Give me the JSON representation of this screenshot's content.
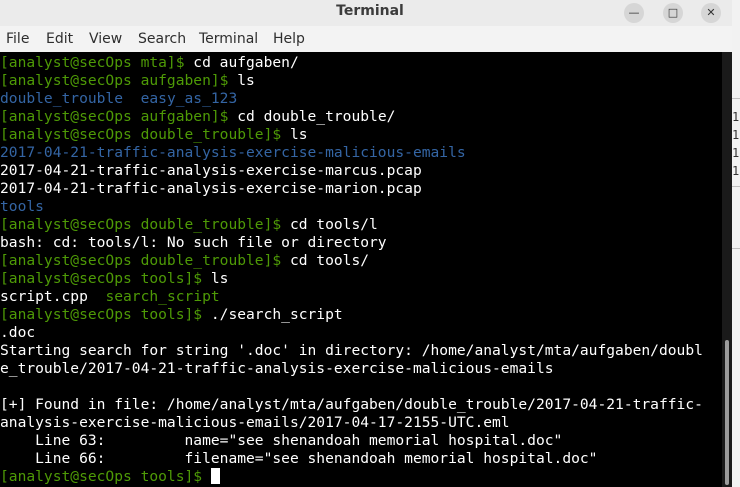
{
  "window": {
    "title": "Terminal"
  },
  "menu": [
    "File",
    "Edit",
    "View",
    "Search",
    "Terminal",
    "Help"
  ],
  "terminal": {
    "lines": [
      [
        {
          "t": "[analyst@secOps mta]$ ",
          "c": "prompt"
        },
        {
          "t": "cd aufgaben/",
          "c": ""
        }
      ],
      [
        {
          "t": "[analyst@secOps aufgaben]$ ",
          "c": "prompt"
        },
        {
          "t": "ls",
          "c": ""
        }
      ],
      [
        {
          "t": "double_trouble",
          "c": "dir"
        },
        {
          "t": "  ",
          "c": ""
        },
        {
          "t": "easy_as_123",
          "c": "dir"
        }
      ],
      [
        {
          "t": "[analyst@secOps aufgaben]$ ",
          "c": "prompt"
        },
        {
          "t": "cd double_trouble/",
          "c": ""
        }
      ],
      [
        {
          "t": "[analyst@secOps double_trouble]$ ",
          "c": "prompt"
        },
        {
          "t": "ls",
          "c": ""
        }
      ],
      [
        {
          "t": "2017-04-21-traffic-analysis-exercise-malicious-emails",
          "c": "dir"
        }
      ],
      [
        {
          "t": "2017-04-21-traffic-analysis-exercise-marcus.pcap",
          "c": ""
        }
      ],
      [
        {
          "t": "2017-04-21-traffic-analysis-exercise-marion.pcap",
          "c": ""
        }
      ],
      [
        {
          "t": "tools",
          "c": "dir"
        }
      ],
      [
        {
          "t": "[analyst@secOps double_trouble]$ ",
          "c": "prompt"
        },
        {
          "t": "cd tools/l",
          "c": ""
        }
      ],
      [
        {
          "t": "bash: cd: tools/l: No such file or directory",
          "c": ""
        }
      ],
      [
        {
          "t": "[analyst@secOps double_trouble]$ ",
          "c": "prompt"
        },
        {
          "t": "cd tools/",
          "c": ""
        }
      ],
      [
        {
          "t": "[analyst@secOps tools]$ ",
          "c": "prompt"
        },
        {
          "t": "ls",
          "c": ""
        }
      ],
      [
        {
          "t": "script.cpp",
          "c": ""
        },
        {
          "t": "  ",
          "c": ""
        },
        {
          "t": "search_script",
          "c": "exe"
        }
      ],
      [
        {
          "t": "[analyst@secOps tools]$ ",
          "c": "prompt"
        },
        {
          "t": "./search_script",
          "c": ""
        }
      ],
      [
        {
          "t": ".doc",
          "c": ""
        }
      ],
      [
        {
          "t": "Starting search for string '.doc' in directory: /home/analyst/mta/aufgaben/doubl",
          "c": ""
        }
      ],
      [
        {
          "t": "e_trouble/2017-04-21-traffic-analysis-exercise-malicious-emails",
          "c": ""
        }
      ],
      [
        {
          "t": "",
          "c": ""
        }
      ],
      [
        {
          "t": "[+] Found in file: /home/analyst/mta/aufgaben/double_trouble/2017-04-21-traffic-",
          "c": ""
        }
      ],
      [
        {
          "t": "analysis-exercise-malicious-emails/2017-04-17-2155-UTC.eml",
          "c": ""
        }
      ],
      [
        {
          "t": "    Line 63:         name=\"see shenandoah memorial hospital.doc\"",
          "c": ""
        }
      ],
      [
        {
          "t": "    Line 66:         filename=\"see shenandoah memorial hospital.doc\"",
          "c": ""
        }
      ],
      [
        {
          "t": "[analyst@secOps tools]$ ",
          "c": "prompt"
        },
        {
          "t": "",
          "c": "cursor"
        }
      ]
    ]
  },
  "background_window": {
    "glyphs": [
      "1",
      "1",
      "1",
      "1"
    ]
  }
}
